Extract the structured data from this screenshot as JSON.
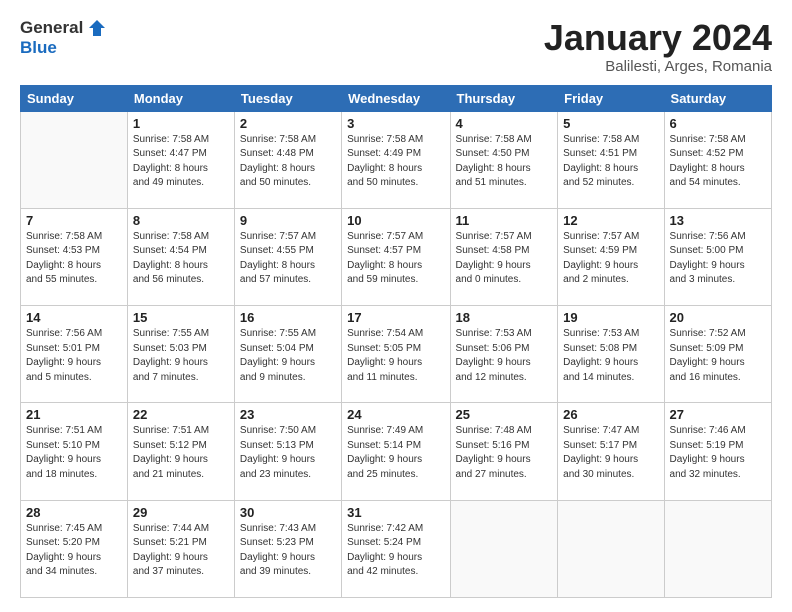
{
  "header": {
    "logo_general": "General",
    "logo_blue": "Blue",
    "main_title": "January 2024",
    "sub_title": "Balilesti, Arges, Romania"
  },
  "days_of_week": [
    "Sunday",
    "Monday",
    "Tuesday",
    "Wednesday",
    "Thursday",
    "Friday",
    "Saturday"
  ],
  "weeks": [
    [
      {
        "num": "",
        "info": ""
      },
      {
        "num": "1",
        "info": "Sunrise: 7:58 AM\nSunset: 4:47 PM\nDaylight: 8 hours\nand 49 minutes."
      },
      {
        "num": "2",
        "info": "Sunrise: 7:58 AM\nSunset: 4:48 PM\nDaylight: 8 hours\nand 50 minutes."
      },
      {
        "num": "3",
        "info": "Sunrise: 7:58 AM\nSunset: 4:49 PM\nDaylight: 8 hours\nand 50 minutes."
      },
      {
        "num": "4",
        "info": "Sunrise: 7:58 AM\nSunset: 4:50 PM\nDaylight: 8 hours\nand 51 minutes."
      },
      {
        "num": "5",
        "info": "Sunrise: 7:58 AM\nSunset: 4:51 PM\nDaylight: 8 hours\nand 52 minutes."
      },
      {
        "num": "6",
        "info": "Sunrise: 7:58 AM\nSunset: 4:52 PM\nDaylight: 8 hours\nand 54 minutes."
      }
    ],
    [
      {
        "num": "7",
        "info": "Sunrise: 7:58 AM\nSunset: 4:53 PM\nDaylight: 8 hours\nand 55 minutes."
      },
      {
        "num": "8",
        "info": "Sunrise: 7:58 AM\nSunset: 4:54 PM\nDaylight: 8 hours\nand 56 minutes."
      },
      {
        "num": "9",
        "info": "Sunrise: 7:57 AM\nSunset: 4:55 PM\nDaylight: 8 hours\nand 57 minutes."
      },
      {
        "num": "10",
        "info": "Sunrise: 7:57 AM\nSunset: 4:57 PM\nDaylight: 8 hours\nand 59 minutes."
      },
      {
        "num": "11",
        "info": "Sunrise: 7:57 AM\nSunset: 4:58 PM\nDaylight: 9 hours\nand 0 minutes."
      },
      {
        "num": "12",
        "info": "Sunrise: 7:57 AM\nSunset: 4:59 PM\nDaylight: 9 hours\nand 2 minutes."
      },
      {
        "num": "13",
        "info": "Sunrise: 7:56 AM\nSunset: 5:00 PM\nDaylight: 9 hours\nand 3 minutes."
      }
    ],
    [
      {
        "num": "14",
        "info": "Sunrise: 7:56 AM\nSunset: 5:01 PM\nDaylight: 9 hours\nand 5 minutes."
      },
      {
        "num": "15",
        "info": "Sunrise: 7:55 AM\nSunset: 5:03 PM\nDaylight: 9 hours\nand 7 minutes."
      },
      {
        "num": "16",
        "info": "Sunrise: 7:55 AM\nSunset: 5:04 PM\nDaylight: 9 hours\nand 9 minutes."
      },
      {
        "num": "17",
        "info": "Sunrise: 7:54 AM\nSunset: 5:05 PM\nDaylight: 9 hours\nand 11 minutes."
      },
      {
        "num": "18",
        "info": "Sunrise: 7:53 AM\nSunset: 5:06 PM\nDaylight: 9 hours\nand 12 minutes."
      },
      {
        "num": "19",
        "info": "Sunrise: 7:53 AM\nSunset: 5:08 PM\nDaylight: 9 hours\nand 14 minutes."
      },
      {
        "num": "20",
        "info": "Sunrise: 7:52 AM\nSunset: 5:09 PM\nDaylight: 9 hours\nand 16 minutes."
      }
    ],
    [
      {
        "num": "21",
        "info": "Sunrise: 7:51 AM\nSunset: 5:10 PM\nDaylight: 9 hours\nand 18 minutes."
      },
      {
        "num": "22",
        "info": "Sunrise: 7:51 AM\nSunset: 5:12 PM\nDaylight: 9 hours\nand 21 minutes."
      },
      {
        "num": "23",
        "info": "Sunrise: 7:50 AM\nSunset: 5:13 PM\nDaylight: 9 hours\nand 23 minutes."
      },
      {
        "num": "24",
        "info": "Sunrise: 7:49 AM\nSunset: 5:14 PM\nDaylight: 9 hours\nand 25 minutes."
      },
      {
        "num": "25",
        "info": "Sunrise: 7:48 AM\nSunset: 5:16 PM\nDaylight: 9 hours\nand 27 minutes."
      },
      {
        "num": "26",
        "info": "Sunrise: 7:47 AM\nSunset: 5:17 PM\nDaylight: 9 hours\nand 30 minutes."
      },
      {
        "num": "27",
        "info": "Sunrise: 7:46 AM\nSunset: 5:19 PM\nDaylight: 9 hours\nand 32 minutes."
      }
    ],
    [
      {
        "num": "28",
        "info": "Sunrise: 7:45 AM\nSunset: 5:20 PM\nDaylight: 9 hours\nand 34 minutes."
      },
      {
        "num": "29",
        "info": "Sunrise: 7:44 AM\nSunset: 5:21 PM\nDaylight: 9 hours\nand 37 minutes."
      },
      {
        "num": "30",
        "info": "Sunrise: 7:43 AM\nSunset: 5:23 PM\nDaylight: 9 hours\nand 39 minutes."
      },
      {
        "num": "31",
        "info": "Sunrise: 7:42 AM\nSunset: 5:24 PM\nDaylight: 9 hours\nand 42 minutes."
      },
      {
        "num": "",
        "info": ""
      },
      {
        "num": "",
        "info": ""
      },
      {
        "num": "",
        "info": ""
      }
    ]
  ]
}
